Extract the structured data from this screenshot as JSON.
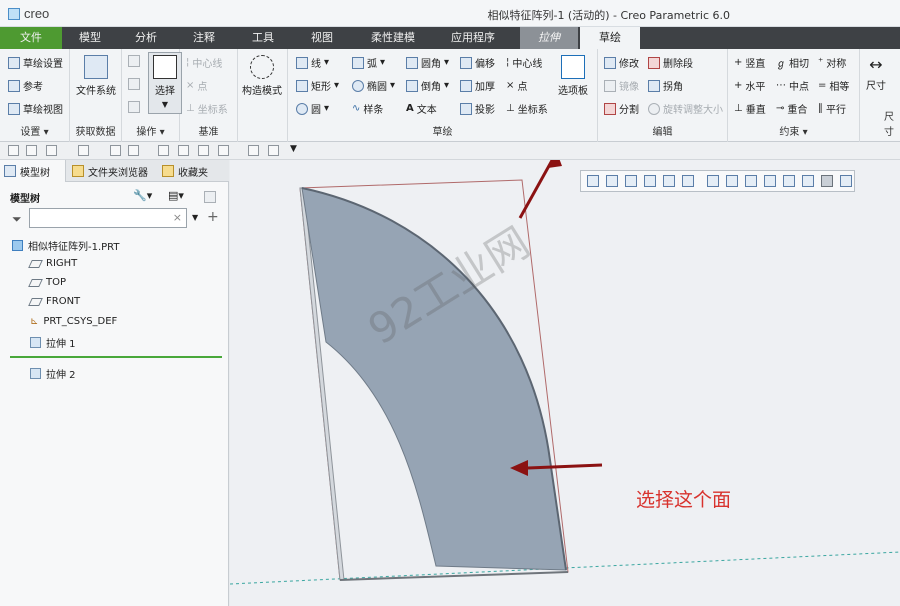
{
  "app": {
    "logo_text": "creo",
    "window_title": "相似特征阵列-1 (活动的) - Creo Parametric 6.0"
  },
  "tabs": {
    "file": "文件",
    "model": "模型",
    "analysis": "分析",
    "annotate": "注释",
    "tools": "工具",
    "view": "视图",
    "flexible_modeling": "柔性建模",
    "applications": "应用程序",
    "extrude": "拉伸",
    "sketch": "草绘"
  },
  "ribbon": {
    "setup": {
      "label": "设置",
      "sketch_setup": "草绘设置",
      "references": "参考",
      "sketch_view": "草绘视图"
    },
    "get_data": {
      "label": "获取数据",
      "file_system": "文件系统"
    },
    "operations": {
      "label": "操作",
      "select": "选择"
    },
    "datum": {
      "label": "基准",
      "centerline": "中心线",
      "point": "点",
      "coord_sys": "坐标系"
    },
    "construction_mode": "构造模式",
    "sketching": {
      "label": "草绘",
      "line": "线",
      "arc": "弧",
      "fillet": "圆角",
      "offset": "偏移",
      "centerline": "中心线",
      "rectangle": "矩形",
      "ellipse": "椭圆",
      "chamfer": "倒角",
      "thicken": "加厚",
      "point": "点",
      "circle": "圆",
      "spline": "样条",
      "text": "文本",
      "project": "投影",
      "coord_sys": "坐标系",
      "palette": "选项板"
    },
    "editing": {
      "label": "编辑",
      "modify": "修改",
      "delete_segment": "删除段",
      "mirror": "镜像",
      "corner": "拐角",
      "divide": "分割",
      "rotate_resize": "旋转调整大小"
    },
    "constrain": {
      "label": "约束",
      "vertical": "竖直",
      "tangent": "相切",
      "symmetric": "对称",
      "horizontal": "水平",
      "midpoint": "中点",
      "equal": "相等",
      "perpendicular": "垂直",
      "coincident": "重合",
      "parallel": "平行"
    },
    "dimension": {
      "label": "尺寸",
      "dimension": "尺寸"
    }
  },
  "sidebar": {
    "tabs": [
      "模型树",
      "文件夹浏览器",
      "收藏夹"
    ],
    "header": "模型树",
    "tree": {
      "part": "相似特征阵列-1.PRT",
      "items": [
        "RIGHT",
        "TOP",
        "FRONT",
        "PRT_CSYS_DEF",
        "拉伸 1"
      ],
      "inserting": "拉伸 2"
    }
  },
  "viewport": {
    "annotation": "选择这个面",
    "watermark": "92工业网"
  },
  "colors": {
    "file_tab": "#4e9a31",
    "face_fill": "#96a4b4",
    "annotation": "#d8322d",
    "arrow": "#8b1212"
  }
}
